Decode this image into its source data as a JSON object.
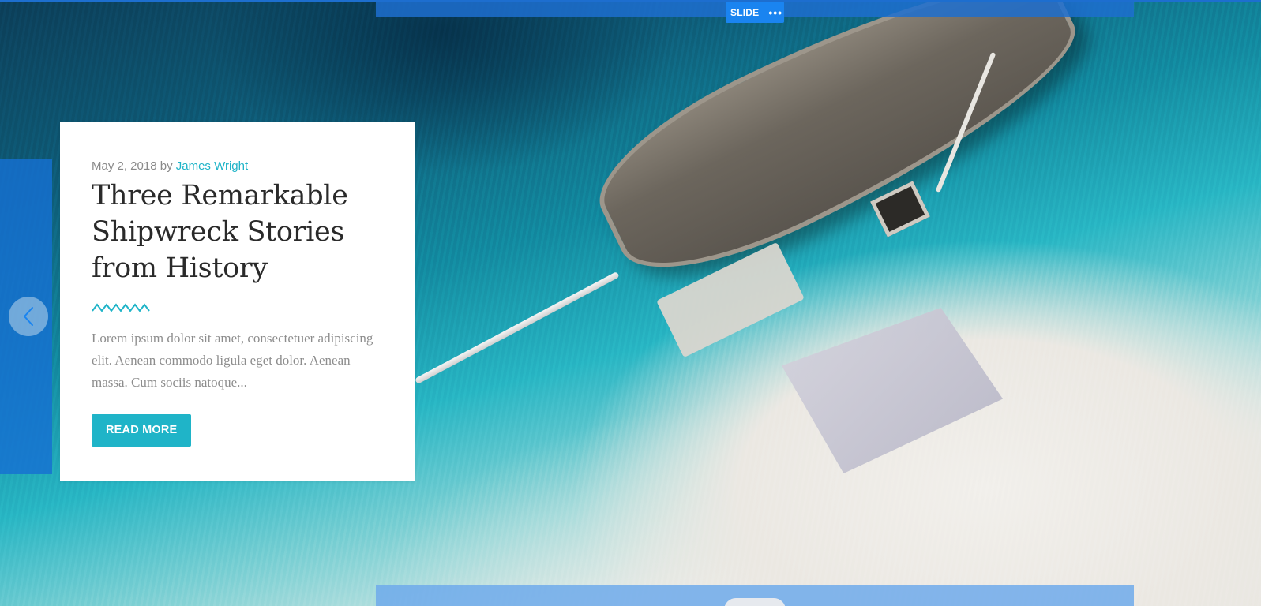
{
  "editor": {
    "slide_label": "SLIDE",
    "slide_menu": "•••"
  },
  "post": {
    "date": "May 2, 2018",
    "by": "by",
    "author": "James Wright",
    "title": "Three Remarkable Shipwreck Stories from History",
    "excerpt": "Lorem ipsum dolor sit amet, consectetuer adipiscing elit. Aenean commodo ligula eget dolor. Aenean massa. Cum sociis natoque...",
    "read_more": "READ MORE"
  },
  "icons": {
    "prev": "chevron-left-icon",
    "divider": "zigzag-divider"
  },
  "colors": {
    "accent": "#1fb4c8",
    "editor_blue": "#1a84f0"
  }
}
